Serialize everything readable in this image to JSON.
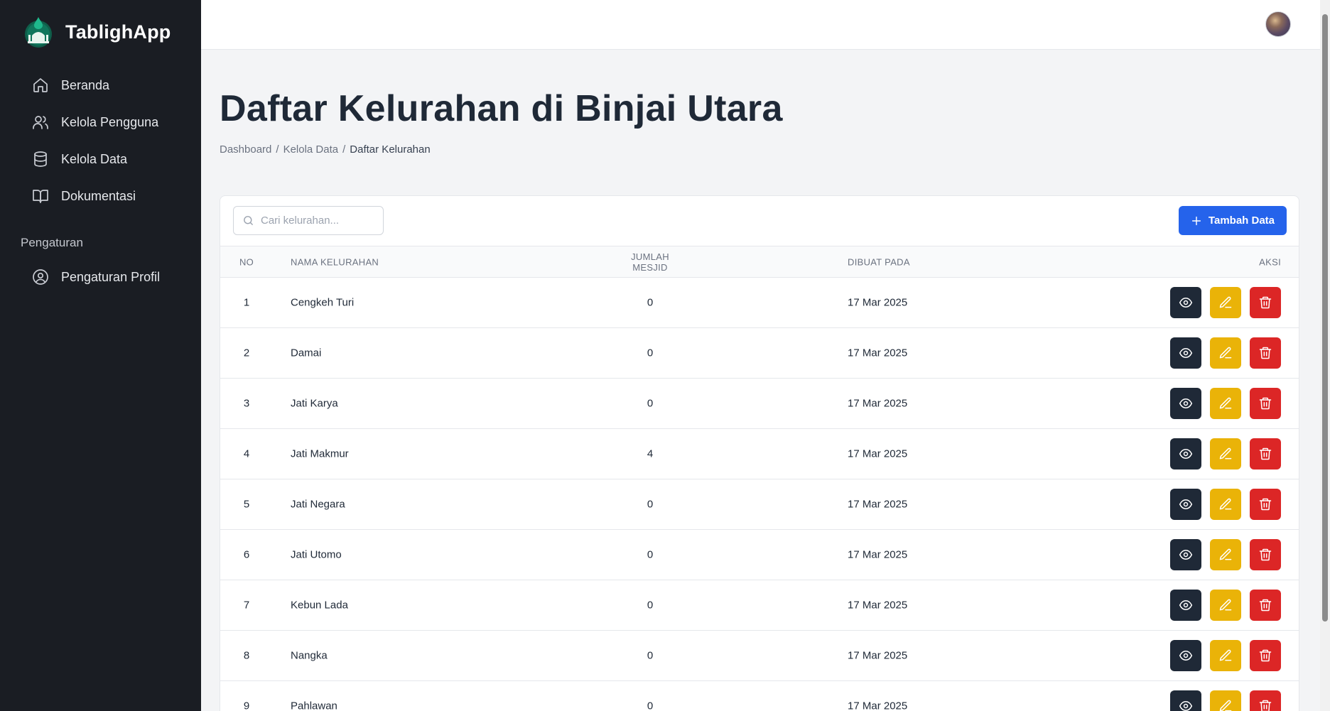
{
  "app": {
    "name": "TablighApp"
  },
  "sidebar": {
    "items": [
      {
        "label": "Beranda",
        "icon": "home-icon"
      },
      {
        "label": "Kelola Pengguna",
        "icon": "users-icon"
      },
      {
        "label": "Kelola Data",
        "icon": "database-icon"
      },
      {
        "label": "Dokumentasi",
        "icon": "book-icon"
      }
    ],
    "section_label": "Pengaturan",
    "settings_items": [
      {
        "label": "Pengaturan Profil",
        "icon": "user-circle-icon"
      }
    ]
  },
  "page": {
    "title": "Daftar Kelurahan di Binjai Utara",
    "breadcrumb": [
      "Dashboard",
      "Kelola Data",
      "Daftar Kelurahan"
    ],
    "breadcrumb_separator": "/"
  },
  "toolbar": {
    "search_placeholder": "Cari kelurahan...",
    "add_label": "Tambah Data"
  },
  "table": {
    "headers": {
      "no": "NO",
      "name": "NAMA KELURAHAN",
      "count": "JUMLAH MESJID",
      "date": "DIBUAT PADA",
      "actions": "AKSI"
    },
    "rows": [
      {
        "no": "1",
        "name": "Cengkeh Turi",
        "count": "0",
        "date": "17 Mar 2025"
      },
      {
        "no": "2",
        "name": "Damai",
        "count": "0",
        "date": "17 Mar 2025"
      },
      {
        "no": "3",
        "name": "Jati Karya",
        "count": "0",
        "date": "17 Mar 2025"
      },
      {
        "no": "4",
        "name": "Jati Makmur",
        "count": "4",
        "date": "17 Mar 2025"
      },
      {
        "no": "5",
        "name": "Jati Negara",
        "count": "0",
        "date": "17 Mar 2025"
      },
      {
        "no": "6",
        "name": "Jati Utomo",
        "count": "0",
        "date": "17 Mar 2025"
      },
      {
        "no": "7",
        "name": "Kebun Lada",
        "count": "0",
        "date": "17 Mar 2025"
      },
      {
        "no": "8",
        "name": "Nangka",
        "count": "0",
        "date": "17 Mar 2025"
      },
      {
        "no": "9",
        "name": "Pahlawan",
        "count": "0",
        "date": "17 Mar 2025"
      }
    ]
  },
  "colors": {
    "sidebar_bg": "#1a1d23",
    "primary": "#2563eb",
    "view_button": "#1f2937",
    "edit_button": "#eab308",
    "delete_button": "#dc2626"
  }
}
